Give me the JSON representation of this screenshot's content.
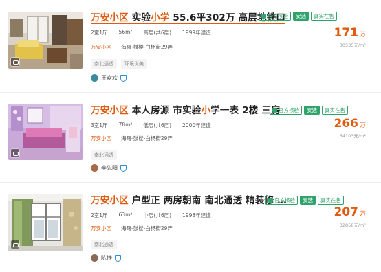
{
  "listings": [
    {
      "title": {
        "part1": "万安小区",
        "part2": " 实验",
        "part3": "小学",
        "part4": " 55.6平302万 高层地铁口"
      },
      "badges": {
        "official": "官方核验",
        "safe": "安选",
        "real": "真实在售"
      },
      "meta": {
        "layout": "2室1厅",
        "size": "56m²",
        "floor": "高层(共6层)",
        "year": "1999年建造"
      },
      "community": "万安小区",
      "area": "海曙-鼓楼-白杨街29弄",
      "tags": [
        "南北通透",
        "环境优美"
      ],
      "agent": "王欢欢",
      "price": "171",
      "price_unit": "万",
      "unit_price": "30535元/m²"
    },
    {
      "title": {
        "part1": "万安小区",
        "part2": " 本人房源 市实验",
        "part3": "小",
        "part4": "学一表 2楼 三房"
      },
      "badges": {
        "official": "官方核验",
        "safe": "安选",
        "real": "真实在售"
      },
      "meta": {
        "layout": "3室1厅",
        "size": "78m²",
        "floor": "低层(共6层)",
        "year": "2000年建造"
      },
      "community": "万安小区",
      "area": "海曙-鼓楼-白杨街29弄",
      "tags": [
        "南北通透"
      ],
      "agent": "李先阳",
      "price": "266",
      "price_unit": "万",
      "unit_price": "34103元/m²"
    },
    {
      "title": {
        "part1": "万安小区",
        "part2": " 户型正 两房朝南 南北通透 精装修 …"
      },
      "badges": {
        "official": "官方核验",
        "safe": "安选",
        "real": "真实在售"
      },
      "meta": {
        "layout": "2室1厅",
        "size": "63m²",
        "floor": "中层(共6层)",
        "year": "1998年建造"
      },
      "community": "万安小区",
      "area": "海曙-鼓楼-白杨街29弄",
      "tags": [
        "南北通透"
      ],
      "agent": "陈捷",
      "price": "207",
      "price_unit": "万",
      "unit_price": "32858元/m²"
    }
  ],
  "colors": {
    "accent": "#e05a10",
    "verify_green": "#2fa36b",
    "vip_blue": "#2b8fd8"
  }
}
